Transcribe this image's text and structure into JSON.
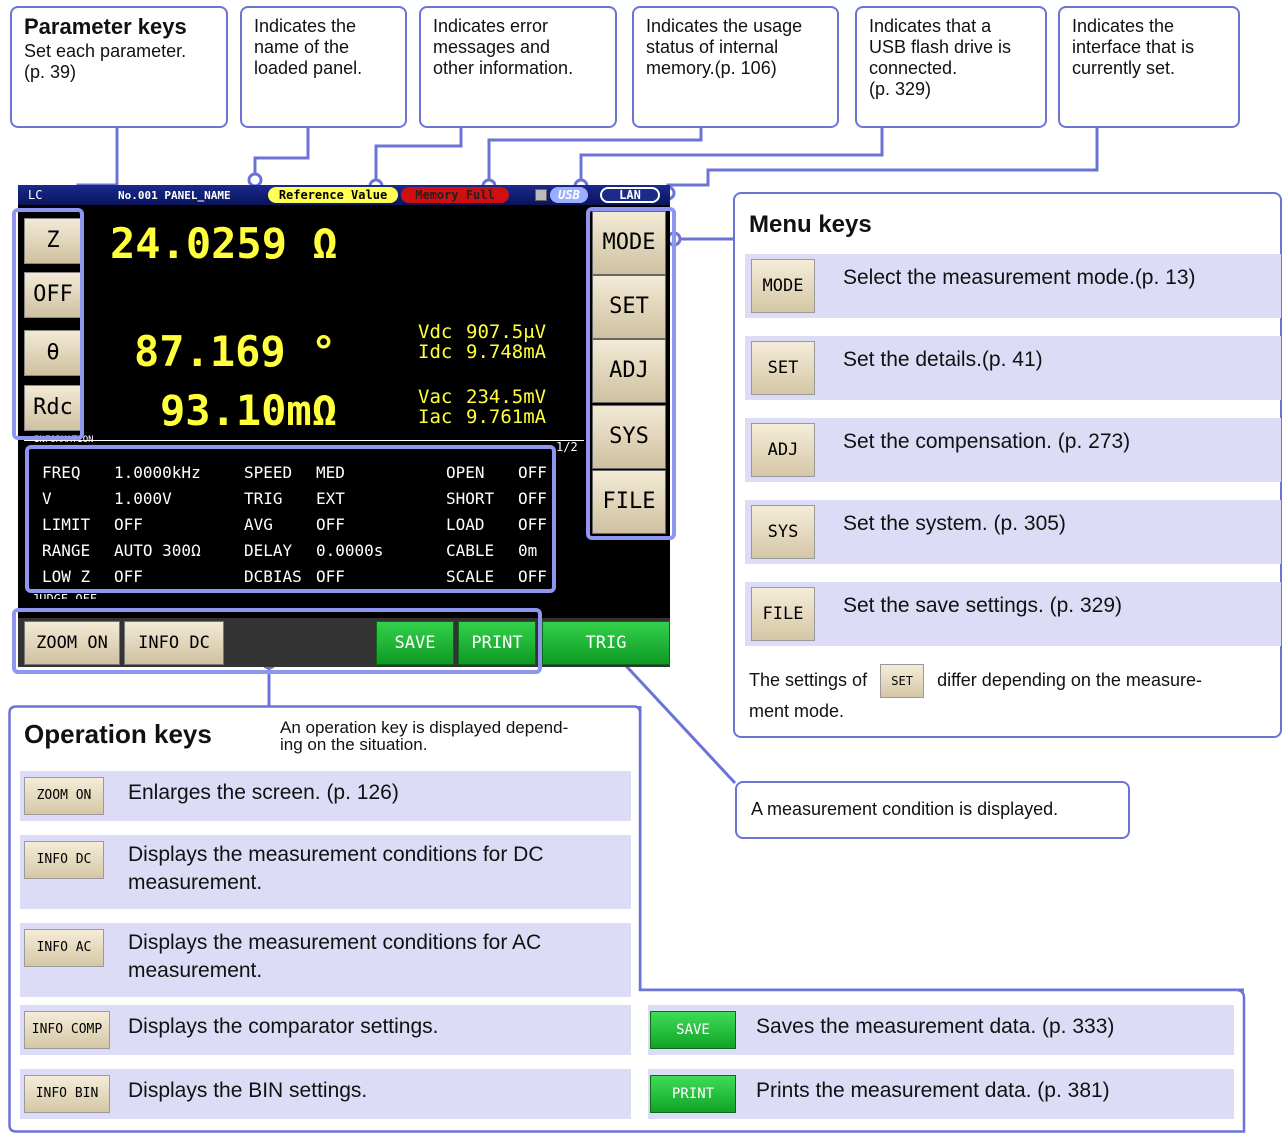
{
  "callouts": {
    "param": {
      "title": "Parameter keys",
      "desc": "Set each parameter.",
      "ref": "(p. 39)"
    },
    "panel": {
      "l1": "Indicates the",
      "l2": "name of the",
      "l3": "loaded panel."
    },
    "error": {
      "l1": "Indicates error",
      "l2": "messages and",
      "l3": "other information."
    },
    "memory": {
      "l1": "Indicates the usage",
      "l2": "status of internal",
      "l3": "memory.(p. 106)"
    },
    "usb": {
      "l1": "Indicates that a",
      "l2": "USB flash drive is",
      "l3": "connected.",
      "l4": "(p. 329)"
    },
    "iface": {
      "l1": "Indicates the",
      "l2": "interface that is",
      "l3": "currently set."
    }
  },
  "screen": {
    "mode": "LC",
    "panel_name": "No.001 PANEL_NAME",
    "ref_value": "Reference Value",
    "memory_full": "Memory Full",
    "usb": "USB",
    "lan": "LAN",
    "param_keys": [
      "Z",
      "OFF",
      "θ",
      "Rdc"
    ],
    "value1": "24.0259 Ω",
    "value2": "87.169 °",
    "value3": "93.10mΩ",
    "vdc_label": "Vdc",
    "vdc": "907.5μV",
    "idc_label": "Idc",
    "idc": "9.748mA",
    "vac_label": "Vac",
    "vac": "234.5mV",
    "iac_label": "Iac",
    "iac": "9.761mA",
    "info_label": "INFORMATION",
    "page": "1/2",
    "menu_keys": [
      "MODE",
      "SET",
      "ADJ",
      "SYS",
      "FILE"
    ],
    "conditions": [
      [
        "FREQ",
        "1.0000kHz",
        "SPEED",
        "MED",
        "OPEN",
        "OFF"
      ],
      [
        "V",
        "1.000V",
        "TRIG",
        "EXT",
        "SHORT",
        "OFF"
      ],
      [
        "LIMIT",
        "OFF",
        "AVG",
        "OFF",
        "LOAD",
        "OFF"
      ],
      [
        "RANGE",
        "AUTO  300Ω",
        "DELAY",
        "0.0000s",
        "CABLE",
        "0m"
      ],
      [
        "LOW Z",
        "OFF",
        "DCBIAS",
        "OFF",
        "SCALE",
        "OFF"
      ]
    ],
    "cut_row": "JUDGE  OFF",
    "op_keys": {
      "zoom": "ZOOM ON",
      "info_dc": "INFO DC",
      "save": "SAVE",
      "print": "PRINT",
      "trig": "TRIG"
    }
  },
  "menu_panel": {
    "title": "Menu keys",
    "rows": [
      {
        "key": "MODE",
        "desc": "Select the measurement mode.(p. 13)"
      },
      {
        "key": "SET",
        "desc": "Set the details.(p. 41)"
      },
      {
        "key": "ADJ",
        "desc": "Set the compensation. (p. 273)"
      },
      {
        "key": "SYS",
        "desc": "Set the system. (p. 305)"
      },
      {
        "key": "FILE",
        "desc": "Set the save settings. (p. 329)"
      }
    ],
    "note_pre": "The settings of",
    "note_key": "SET",
    "note_post": "differ depending on the measure-",
    "note_l2": "ment mode."
  },
  "cond_callout": "A measurement condition is displayed.",
  "op_panel": {
    "title": "Operation keys",
    "subtitle_l1": "An operation key is displayed depend-",
    "subtitle_l2": "ing on the situation.",
    "rows": [
      {
        "key": "ZOOM ON",
        "l1": "Enlarges the screen. (p. 126)",
        "l2": ""
      },
      {
        "key": "INFO DC",
        "l1": "Displays the measurement conditions for DC",
        "l2": "measurement."
      },
      {
        "key": "INFO AC",
        "l1": "Displays the measurement conditions for AC",
        "l2": "measurement."
      },
      {
        "key": "INFO COMP",
        "l1": "Displays the comparator settings.",
        "l2": ""
      },
      {
        "key": "INFO BIN",
        "l1": "Displays the BIN settings.",
        "l2": ""
      }
    ],
    "right_rows": [
      {
        "key": "SAVE",
        "desc": "Saves the measurement data. (p. 333)"
      },
      {
        "key": "PRINT",
        "desc": "Prints the measurement data. (p. 381)"
      }
    ]
  },
  "colors": {
    "accent": "#6b74d6",
    "row_bg": "#dcdcf6",
    "value_yellow": "#ffff3c",
    "green": "#1db334"
  }
}
